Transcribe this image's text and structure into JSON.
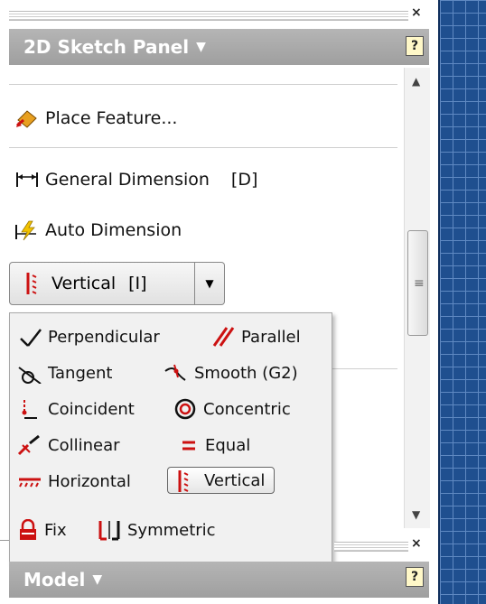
{
  "panel_title": "2D Sketch Panel",
  "help_symbol": "?",
  "close_symbol": "×",
  "items": {
    "place_feature": "Place Feature...",
    "general_dimension": "General Dimension",
    "general_dimension_shortcut": "[D]",
    "auto_dimension": "Auto Dimension"
  },
  "split_button": {
    "label": "Vertical",
    "shortcut": "[I]"
  },
  "constraints": [
    {
      "label": "Perpendicular",
      "icon": "perpendicular-icon"
    },
    {
      "label": "Parallel",
      "icon": "parallel-icon"
    },
    {
      "label": "Tangent",
      "icon": "tangent-icon"
    },
    {
      "label": "Smooth (G2)",
      "icon": "smooth-icon"
    },
    {
      "label": "Coincident",
      "icon": "coincident-icon"
    },
    {
      "label": "Concentric",
      "icon": "concentric-icon"
    },
    {
      "label": "Collinear",
      "icon": "collinear-icon"
    },
    {
      "label": "Equal",
      "icon": "equal-icon"
    },
    {
      "label": "Horizontal",
      "icon": "horizontal-icon"
    },
    {
      "label": "Vertical",
      "icon": "vertical-icon",
      "selected": true
    },
    {
      "label": "Fix",
      "icon": "fix-icon"
    },
    {
      "label": "Symmetric",
      "icon": "symmetric-icon"
    }
  ],
  "bottom_panel_title": "Model",
  "colors": {
    "header_bg": "#a9a9a9",
    "canvas_blue": "#1f4f8f",
    "icon_red": "#cc1111"
  }
}
